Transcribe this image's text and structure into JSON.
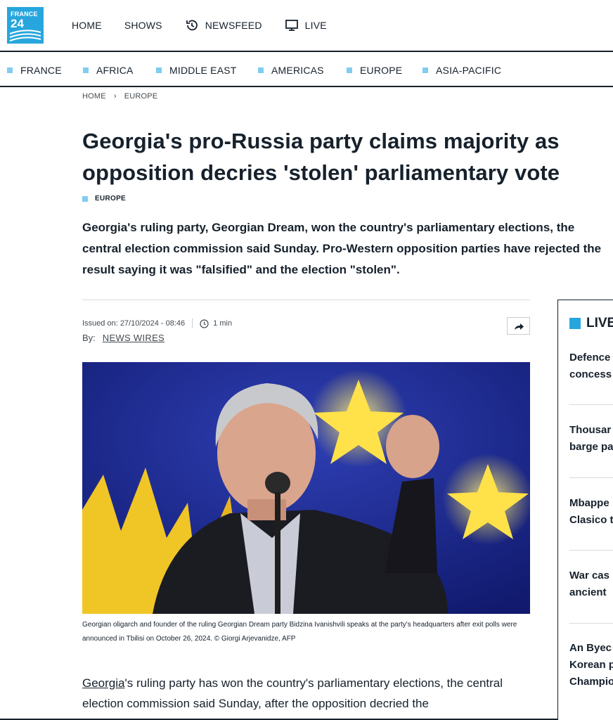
{
  "brand": {
    "line1": "FRANCE",
    "line2": "24"
  },
  "topnav": {
    "home": "HOME",
    "shows": "SHOWS",
    "newsfeed": "NEWSFEED",
    "live": "LIVE"
  },
  "sections": [
    "FRANCE",
    "AFRICA",
    "MIDDLE EAST",
    "AMERICAS",
    "EUROPE",
    "ASIA-PACIFIC"
  ],
  "breadcrumb": {
    "home": "HOME",
    "sep": "›",
    "current": "EUROPE"
  },
  "article": {
    "title": "Georgia's pro-Russia party claims majority as opposition decries 'stolen' parliamentary vote",
    "tag": "EUROPE",
    "lead": "Georgia's ruling party, Georgian Dream, won the country's parliamentary elections, the central election commission said Sunday. Pro-Western opposition parties have rejected the result saying it was \"falsified\" and the election \"stolen\".",
    "issued": "Issued on: 27/10/2024 - 08:46",
    "read_time": "1 min",
    "by_label": "By:",
    "author": "NEWS WIRES",
    "caption": "Georgian oligarch and founder of the ruling Georgian Dream party Bidzina Ivanishvili speaks at the party's headquarters after exit polls were announced in Tbilisi on October 26, 2024.  © Giorgi Arjevanidze, AFP",
    "body_link": "Georgia",
    "body_rest": "'s ruling party has won the country's parliamentary elections, the central election commission said Sunday, after the opposition decried the"
  },
  "live": {
    "header": "LIVE",
    "entries": [
      {
        "line1": "Defence",
        "line2": "concess"
      },
      {
        "line1": "Thousar",
        "line2": "barge pa"
      },
      {
        "line1": "Mbappe",
        "line2": "Clasico t"
      },
      {
        "line1": "War cas",
        "line2": "ancient"
      },
      {
        "line1": "An Byec",
        "line2": "Korean p",
        "line3": "Champio"
      }
    ]
  },
  "colors": {
    "accent": "#27a6dd",
    "section_square": "#7fcdf0",
    "ink": "#16212c"
  }
}
